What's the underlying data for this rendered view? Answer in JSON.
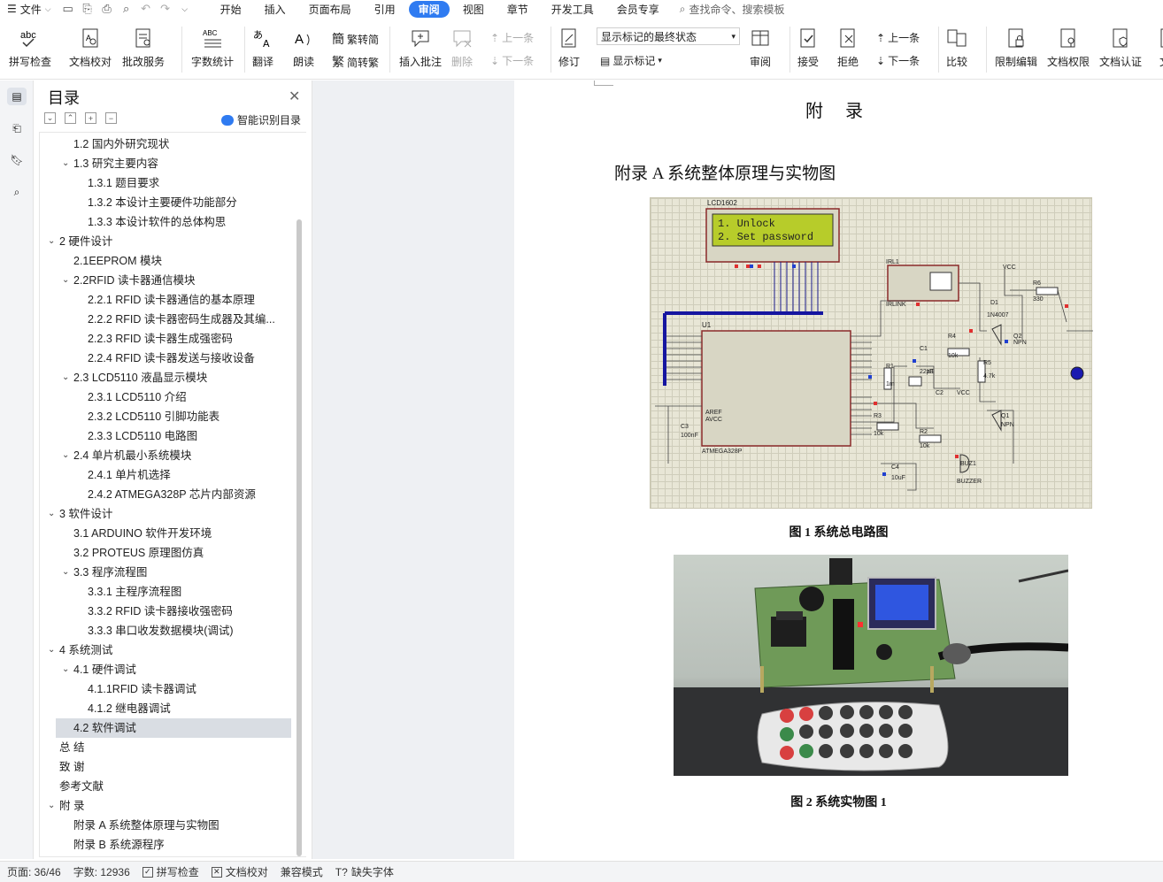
{
  "menubar": {
    "file_label": "文件",
    "tabs": [
      "开始",
      "插入",
      "页面布局",
      "引用",
      "审阅",
      "视图",
      "章节",
      "开发工具",
      "会员专享"
    ],
    "active_tab": "审阅",
    "search_placeholder": "查找命令、搜索模板"
  },
  "ribbon": {
    "spell_check": "拼写检查",
    "doc_proof": "文档校对",
    "review_service": "批改服务",
    "word_count": "字数统计",
    "translate": "翻译",
    "read_aloud": "朗读",
    "trad_to_simp": "繁转简",
    "simp_to_trad": "简转繁",
    "insert_comment": "插入批注",
    "delete": "删除",
    "prev_comment": "上一条",
    "next_comment": "下一条",
    "track_changes": "修订",
    "markup_state": "显示标记的最终状态",
    "show_markup": "显示标记",
    "review": "审阅",
    "accept": "接受",
    "reject": "拒绝",
    "prev_change": "上一条",
    "next_change": "下一条",
    "compare": "比较",
    "restrict_edit": "限制编辑",
    "doc_permission": "文档权限",
    "doc_certify": "文档认证",
    "doc_cut": "文"
  },
  "toc": {
    "title": "目录",
    "smart_label": "智能识别目录",
    "items": [
      {
        "text": "1.2 国内外研究现状",
        "level": 2,
        "caret": false
      },
      {
        "text": "1.3 研究主要内容",
        "level": 2,
        "caret": true
      },
      {
        "text": "1.3.1 题目要求",
        "level": 3,
        "caret": false
      },
      {
        "text": "1.3.2 本设计主要硬件功能部分",
        "level": 3,
        "caret": false
      },
      {
        "text": "1.3.3 本设计软件的总体构思",
        "level": 3,
        "caret": false
      },
      {
        "text": "2 硬件设计",
        "level": 1,
        "caret": true
      },
      {
        "text": "2.1EEPROM 模块",
        "level": 2,
        "caret": false
      },
      {
        "text": "2.2RFID 读卡器通信模块",
        "level": 2,
        "caret": true
      },
      {
        "text": "2.2.1 RFID 读卡器通信的基本原理",
        "level": 3,
        "caret": false
      },
      {
        "text": "2.2.2 RFID 读卡器密码生成器及其编...",
        "level": 3,
        "caret": false
      },
      {
        "text": "2.2.3 RFID 读卡器生成强密码",
        "level": 3,
        "caret": false
      },
      {
        "text": "2.2.4 RFID 读卡器发送与接收设备",
        "level": 3,
        "caret": false
      },
      {
        "text": "2.3 LCD5110 液晶显示模块",
        "level": 2,
        "caret": true
      },
      {
        "text": "2.3.1 LCD5110 介绍",
        "level": 3,
        "caret": false
      },
      {
        "text": "2.3.2 LCD5110 引脚功能表",
        "level": 3,
        "caret": false
      },
      {
        "text": "2.3.3 LCD5110 电路图",
        "level": 3,
        "caret": false
      },
      {
        "text": "2.4 单片机最小系统模块",
        "level": 2,
        "caret": true
      },
      {
        "text": "2.4.1 单片机选择",
        "level": 3,
        "caret": false
      },
      {
        "text": "2.4.2 ATMEGA328P 芯片内部资源",
        "level": 3,
        "caret": false
      },
      {
        "text": "3 软件设计",
        "level": 1,
        "caret": true
      },
      {
        "text": "3.1 ARDUINO 软件开发环境",
        "level": 2,
        "caret": false
      },
      {
        "text": "3.2 PROTEUS 原理图仿真",
        "level": 2,
        "caret": false
      },
      {
        "text": "3.3 程序流程图",
        "level": 2,
        "caret": true
      },
      {
        "text": "3.3.1 主程序流程图",
        "level": 3,
        "caret": false
      },
      {
        "text": "3.3.2 RFID 读卡器接收强密码",
        "level": 3,
        "caret": false
      },
      {
        "text": "3.3.3 串口收发数据模块(调试)",
        "level": 3,
        "caret": false
      },
      {
        "text": "4 系统测试",
        "level": 1,
        "caret": true
      },
      {
        "text": "4.1 硬件调试",
        "level": 2,
        "caret": true
      },
      {
        "text": "4.1.1RFID 读卡器调试",
        "level": 3,
        "caret": false
      },
      {
        "text": "4.1.2 继电器调试",
        "level": 3,
        "caret": false
      },
      {
        "text": "4.2 软件调试",
        "level": 2,
        "caret": false,
        "selected": true
      },
      {
        "text": "总 结",
        "level": 1,
        "caret": false
      },
      {
        "text": "致 谢",
        "level": 1,
        "caret": false
      },
      {
        "text": "参考文献",
        "level": 1,
        "caret": false
      },
      {
        "text": "附 录",
        "level": 1,
        "caret": true
      },
      {
        "text": "附录 A 系统整体原理与实物图",
        "level": 2,
        "caret": false
      },
      {
        "text": "附录 B 系统源程序",
        "level": 2,
        "caret": false
      }
    ]
  },
  "document": {
    "heading": "附 录",
    "section_title": "附录 A 系统整体原理与实物图",
    "figure1_caption": "图 1 系统总电路图",
    "figure2_caption": "图 2 系统实物图 1",
    "schematic": {
      "lcd_name": "LCD1602",
      "lcd_line1": "1. Unlock",
      "lcd_line2": "2. Set password",
      "mcu_name": "U1",
      "mcu_part": "ATMEGA328P",
      "labels": [
        "IRL1",
        "IRLINK",
        "VCC",
        "R6",
        "330",
        "D1",
        "1N4007",
        "R4",
        "10k",
        "Q2",
        "NPN",
        "R5",
        "4.7k",
        "C1",
        "22pF",
        "R1",
        "1m",
        "X1",
        "C2",
        "VCC",
        "C3",
        "100nF",
        "R3",
        "10k",
        "R2",
        "10k",
        "Q1",
        "NPN",
        "C4",
        "10uF",
        "BUZ1",
        "BUZZER",
        "AREF",
        "AVCC"
      ]
    }
  },
  "status": {
    "page": "页面: 36/46",
    "word_count": "字数: 12936",
    "spell_check": "拼写检查",
    "doc_proof": "文档校对",
    "compat_mode": "兼容模式",
    "missing_fonts": "缺失字体"
  },
  "colors": {
    "accent": "#2f7bf1",
    "lcd_green": "#b7cc2a",
    "selected_toc": "#d9dde3"
  }
}
